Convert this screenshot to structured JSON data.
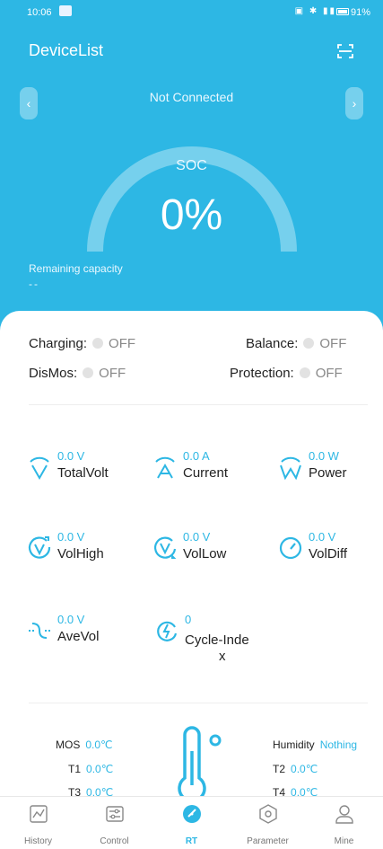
{
  "colors": {
    "accent": "#2db7e4",
    "off_dot": "#e2e2e2"
  },
  "status_bar": {
    "time": "10:06",
    "battery": "91%"
  },
  "header": {
    "title": "DeviceList",
    "scan_icon": "scan-icon"
  },
  "connection": {
    "status": "Not Connected"
  },
  "soc": {
    "label": "SOC",
    "value": "0%",
    "level": 0
  },
  "remaining": {
    "label": "Remaining capacity",
    "value": "--"
  },
  "switches": [
    {
      "label": "Charging:",
      "state": "OFF"
    },
    {
      "label": "Balance:",
      "state": "OFF"
    },
    {
      "label": "DisMos:",
      "state": "OFF"
    },
    {
      "label": "Protection:",
      "state": "OFF"
    }
  ],
  "metrics": [
    {
      "value": "0.0 V",
      "label": "TotalVolt",
      "icon": "voltage-icon"
    },
    {
      "value": "0.0 A",
      "label": "Current",
      "icon": "current-icon"
    },
    {
      "value": "0.0 W",
      "label": "Power",
      "icon": "power-icon"
    },
    {
      "value": "0.0 V",
      "label": "VolHigh",
      "icon": "vol-high-icon"
    },
    {
      "value": "0.0 V",
      "label": "VolLow",
      "icon": "vol-low-icon"
    },
    {
      "value": "0.0 V",
      "label": "VolDiff",
      "icon": "vol-diff-icon"
    },
    {
      "value": "0.0 V",
      "label": "AveVol",
      "icon": "ave-vol-icon"
    },
    {
      "value": "0",
      "label": "Cycle-Inde",
      "label_wrap": "x",
      "icon": "cycle-icon"
    }
  ],
  "temperatures": {
    "left": [
      {
        "label": "MOS",
        "value": "0.0℃"
      },
      {
        "label": "T1",
        "value": "0.0℃"
      },
      {
        "label": "T3",
        "value": "0.0℃"
      }
    ],
    "right": [
      {
        "label": "Humidity",
        "value": "Nothing"
      },
      {
        "label": "T2",
        "value": "0.0℃"
      },
      {
        "label": "T4",
        "value": "0.0℃"
      }
    ]
  },
  "tabs": [
    {
      "label": "History",
      "icon": "history-icon"
    },
    {
      "label": "Control",
      "icon": "control-icon"
    },
    {
      "label": "RT",
      "icon": "rt-gauge-icon",
      "active": true
    },
    {
      "label": "Parameter",
      "icon": "parameter-icon"
    },
    {
      "label": "Mine",
      "icon": "user-icon"
    }
  ]
}
